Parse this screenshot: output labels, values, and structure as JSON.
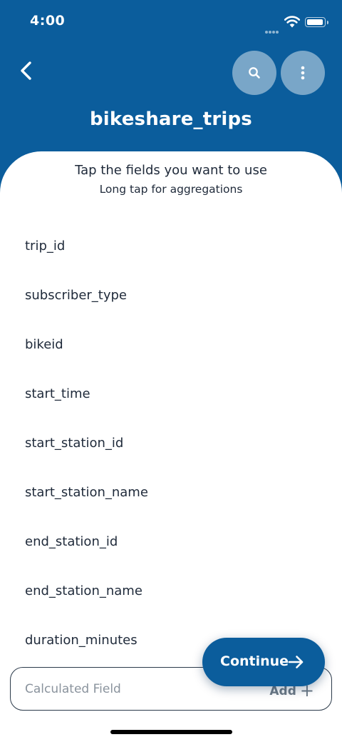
{
  "status_bar": {
    "time": "4:00"
  },
  "header": {
    "title": "bikeshare_trips",
    "back_icon": "chevron-left-icon",
    "search_icon": "search-icon",
    "more_icon": "more-vertical-icon"
  },
  "hints": {
    "main": "Tap the fields you want to use",
    "sub": "Long tap for aggregations"
  },
  "fields": [
    "trip_id",
    "subscriber_type",
    "bikeid",
    "start_time",
    "start_station_id",
    "start_station_name",
    "end_station_id",
    "end_station_name",
    "duration_minutes"
  ],
  "calculated_field": {
    "placeholder": "Calculated Field",
    "value": "",
    "add_label": "Add",
    "add_icon": "plus-icon"
  },
  "continue_button": {
    "label": "Continue",
    "icon": "arrow-right-icon"
  },
  "colors": {
    "primary": "#0b5d9c",
    "text": "#1f2a3a",
    "placeholder": "#8a939d",
    "muted": "#6d7a86"
  }
}
